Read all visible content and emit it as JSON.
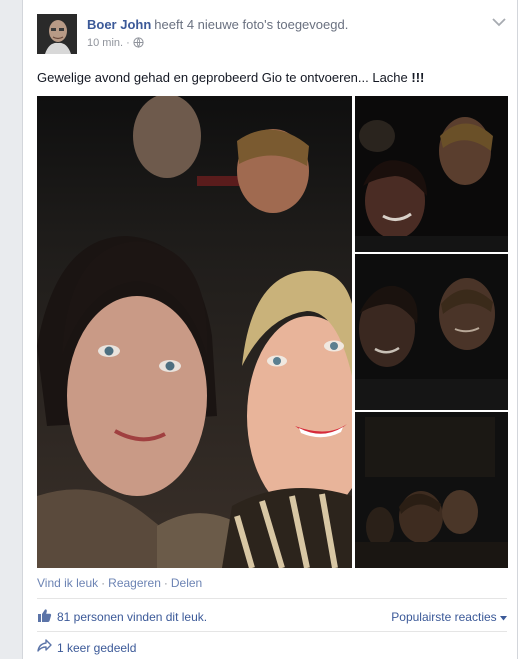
{
  "post": {
    "author": "Boer John",
    "action": "heeft 4 nieuwe foto's toegevoegd.",
    "timestamp": "10 min.",
    "separator": "·",
    "privacy_icon": "globe-icon",
    "text": "Gewelige avond gehad en geprobeerd Gio te ontvoeren... Lache ",
    "text_emphasis": "!!!",
    "photos_count": 4
  },
  "actions": {
    "like": "Vind ik leuk",
    "comment": "Reageren",
    "share": "Delen",
    "sep": "·"
  },
  "stats": {
    "likes_text": "81 personen vinden dit leuk.",
    "top_comments": "Populairste reacties",
    "top_comments_icon": "caret-down-icon",
    "shares_text": "1 keer gedeeld"
  },
  "colors": {
    "link": "#3b5998",
    "muted": "#90949c",
    "background": "#e9ebee"
  }
}
